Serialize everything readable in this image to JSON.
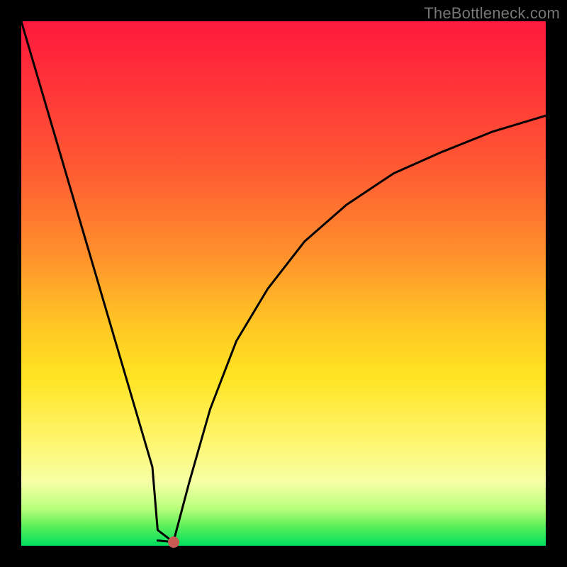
{
  "watermark": "TheBottleneck.com",
  "chart_data": {
    "type": "line",
    "title": "",
    "xlabel": "",
    "ylabel": "",
    "xlim": [
      0,
      1
    ],
    "ylim": [
      0,
      1
    ],
    "trough": {
      "x": 0.29,
      "y": 0.007
    },
    "series": [
      {
        "name": "left",
        "x": [
          0.0,
          0.05,
          0.1,
          0.15,
          0.2,
          0.25,
          0.26,
          0.29
        ],
        "y": [
          1.0,
          0.83,
          0.66,
          0.49,
          0.32,
          0.15,
          0.03,
          0.007
        ]
      },
      {
        "name": "floor",
        "x": [
          0.26,
          0.29
        ],
        "y": [
          0.01,
          0.007
        ]
      },
      {
        "name": "right",
        "x": [
          0.29,
          0.32,
          0.36,
          0.41,
          0.47,
          0.54,
          0.62,
          0.71,
          0.8,
          0.9,
          1.0
        ],
        "y": [
          0.007,
          0.12,
          0.26,
          0.39,
          0.49,
          0.58,
          0.65,
          0.71,
          0.75,
          0.79,
          0.82
        ]
      }
    ],
    "gradient_stops": [
      {
        "pos": 0.0,
        "color": "#ff1a3d"
      },
      {
        "pos": 0.28,
        "color": "#ff5a33"
      },
      {
        "pos": 0.58,
        "color": "#ffc724"
      },
      {
        "pos": 0.8,
        "color": "#fff66f"
      },
      {
        "pos": 1.0,
        "color": "#00e060"
      }
    ]
  }
}
